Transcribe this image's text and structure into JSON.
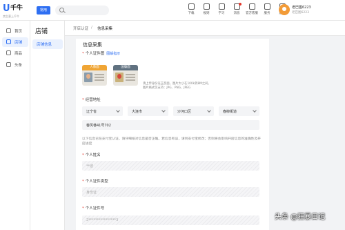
{
  "brand": {
    "mark": "U",
    "name": "千牛",
    "slogan": "卖生意上千牛"
  },
  "header": {
    "common_label": "常用",
    "search_placeholder": "",
    "nav": [
      {
        "label": "下载",
        "icon": "download-icon",
        "dot": false
      },
      {
        "label": "规则",
        "icon": "rules-icon",
        "dot": false
      },
      {
        "label": "学习",
        "icon": "learning-icon",
        "dot": false
      },
      {
        "label": "消息",
        "icon": "message-icon",
        "dot": true
      },
      {
        "label": "官方客服",
        "icon": "customer-service-icon",
        "dot": false
      },
      {
        "label": "服务",
        "icon": "service-icon",
        "dot": false
      },
      {
        "label": "店铺",
        "icon": "store-icon",
        "dot": false
      }
    ],
    "user": {
      "name": "老巴图6223",
      "sub": "老巴图6223",
      "avatar_color": "#f29b38"
    }
  },
  "sidebar": {
    "items": [
      {
        "label": "首页",
        "icon": "home-icon",
        "active": false
      },
      {
        "label": "店铺",
        "icon": "store-icon",
        "active": true
      },
      {
        "label": "商品",
        "icon": "product-icon",
        "active": false
      },
      {
        "label": "头条",
        "icon": "headline-icon",
        "active": false
      }
    ]
  },
  "subside": {
    "title": "店铺",
    "item": "店铺信息"
  },
  "breadcrumb": {
    "first": "开店认证",
    "separator": "/",
    "current": "信息采集"
  },
  "form": {
    "section_title": "信息采集",
    "id_photo": {
      "label": "个人证件图",
      "hint": "图解指示",
      "front_caption": "人像面",
      "back_caption": "国徽面",
      "note": "请上传身份证正反面，图片大小在100k到8M之间，图片格式仅支持：JPG、PNG、JPEG"
    },
    "address": {
      "label": "经营地址",
      "province": "辽宁省",
      "city": "大连市",
      "district": "沙河口区",
      "street": "春柳街道",
      "detail": "春风巷41号702"
    },
    "note": "以下信息已在支付宝认证，请仔细核对信息是否正确。若信息有误，请到支付宝修改；否则将会影响开店信息的准确性及开店进度",
    "name": {
      "label": "个人姓名",
      "placeholder": "**波"
    },
    "id_type": {
      "label": "个人证件类型",
      "placeholder": "身份证"
    },
    "id_number": {
      "label": "个人证件号",
      "placeholder": "2****************3"
    }
  },
  "watermark": "头条 @狂暴日记",
  "colors": {
    "accent": "#2e6ff2",
    "required": "#e2362b",
    "card_front": "#f0a534",
    "card_back": "#607180"
  }
}
